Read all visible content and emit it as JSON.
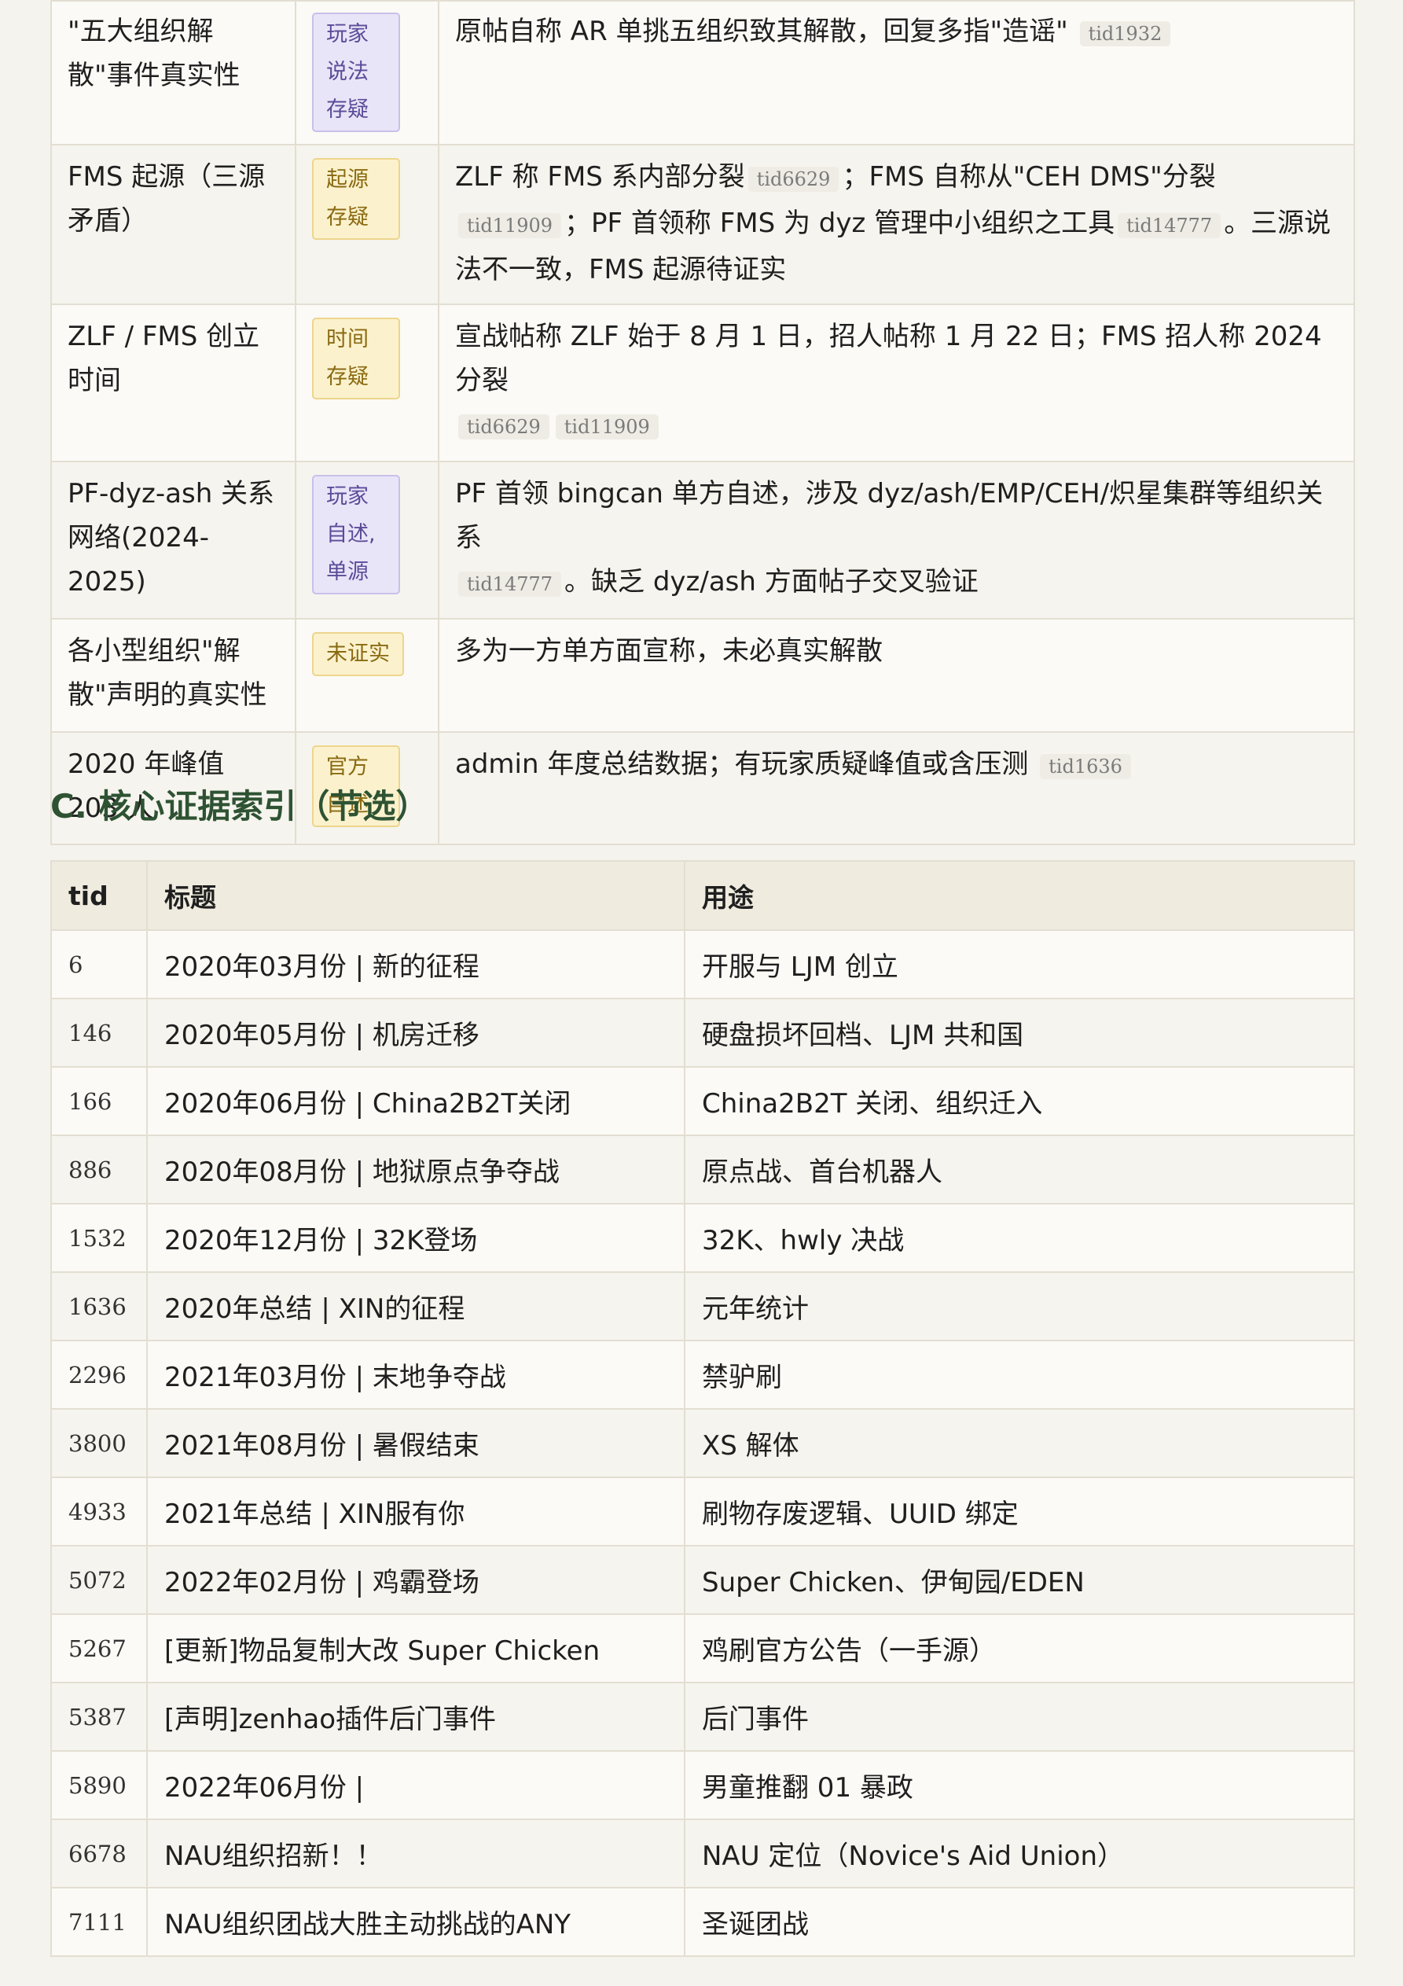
{
  "claims_table": {
    "rows": [
      {
        "topic": "\"五大组织解散\"事件真实性",
        "badge": "玩家说法存疑",
        "badge_color": "purple",
        "detail": "原帖自称 AR 单挑五组织致其解散，回复多指\"造谣\"",
        "tids": [
          "tid1932"
        ]
      },
      {
        "topic": "FMS 起源（三源矛盾）",
        "badge": "起源存疑",
        "badge_color": "yellow",
        "detail_parts": [
          "ZLF 称 FMS 系内部分裂",
          "tid6629",
          "；FMS 自称从\"CEH DMS\"分裂",
          "tid11909",
          "；PF 首领称 FMS 为 dyz 管理中小组织之工具",
          "tid14777",
          "。三源说法不一致，FMS 起源待证实"
        ]
      },
      {
        "topic": "ZLF / FMS 创立时间",
        "badge": "时间存疑",
        "badge_color": "yellow",
        "detail": "宣战帖称 ZLF 始于 8 月 1 日，招人帖称 1 月 22 日；FMS 招人称 2024 分裂",
        "tids": [
          "tid6629",
          "tid11909"
        ]
      },
      {
        "topic": "PF-dyz-ash 关系网络(2024-2025)",
        "badge": "玩家自述,单源",
        "badge_color": "purple",
        "detail_parts": [
          "PF 首领 bingcan 单方自述，涉及 dyz/ash/EMP/CEH/炽星集群等组织关系",
          "tid14777",
          "。缺乏 dyz/ash 方面帖子交叉验证"
        ]
      },
      {
        "topic": "各小型组织\"解散\"声明的真实性",
        "badge": "未证实",
        "badge_color": "yellow",
        "detail": "多为一方单方面宣称，未必真实解散",
        "tids": []
      },
      {
        "topic": "2020 年峰值 203 人",
        "badge": "官方自述",
        "badge_color": "yellow",
        "detail": "admin 年度总结数据；有玩家质疑峰值或含压测",
        "tids": [
          "tid1636"
        ]
      }
    ]
  },
  "section_c": {
    "heading": "C. 核心证据索引（节选）",
    "headers": {
      "tid": "tid",
      "title": "标题",
      "use": "用途"
    },
    "rows": [
      {
        "tid": "6",
        "title": "2020年03月份 | 新的征程",
        "use": "开服与 LJM 创立"
      },
      {
        "tid": "146",
        "title": "2020年05月份 | 机房迁移",
        "use": "硬盘损坏回档、LJM 共和国"
      },
      {
        "tid": "166",
        "title": "2020年06月份 | China2B2T关闭",
        "use": "China2B2T 关闭、组织迁入"
      },
      {
        "tid": "886",
        "title": "2020年08月份 | 地狱原点争夺战",
        "use": "原点战、首台机器人"
      },
      {
        "tid": "1532",
        "title": "2020年12月份 | 32K登场",
        "use": "32K、hwly 决战"
      },
      {
        "tid": "1636",
        "title": "2020年总结 | XIN的征程",
        "use": "元年统计"
      },
      {
        "tid": "2296",
        "title": "2021年03月份 | 末地争夺战",
        "use": "禁驴刷"
      },
      {
        "tid": "3800",
        "title": "2021年08月份 | 暑假结束",
        "use": "XS 解体"
      },
      {
        "tid": "4933",
        "title": "2021年总结 | XIN服有你",
        "use": "刷物存废逻辑、UUID 绑定"
      },
      {
        "tid": "5072",
        "title": "2022年02月份 | 鸡霸登场",
        "use": "Super Chicken、伊甸园/EDEN"
      },
      {
        "tid": "5267",
        "title": "[更新]物品复制大改 Super Chicken",
        "use": "鸡刷官方公告（一手源）"
      },
      {
        "tid": "5387",
        "title": "[声明]zenhao插件后门事件",
        "use": "后门事件"
      },
      {
        "tid": "5890",
        "title": "2022年06月份 |",
        "use": "男童推翻 01 暴政"
      },
      {
        "tid": "6678",
        "title": "NAU组织招新！！",
        "use": "NAU 定位（Novice's Aid Union）"
      },
      {
        "tid": "7111",
        "title": "NAU组织团战大胜主动挑战的ANY",
        "use": "圣诞团战"
      }
    ]
  }
}
